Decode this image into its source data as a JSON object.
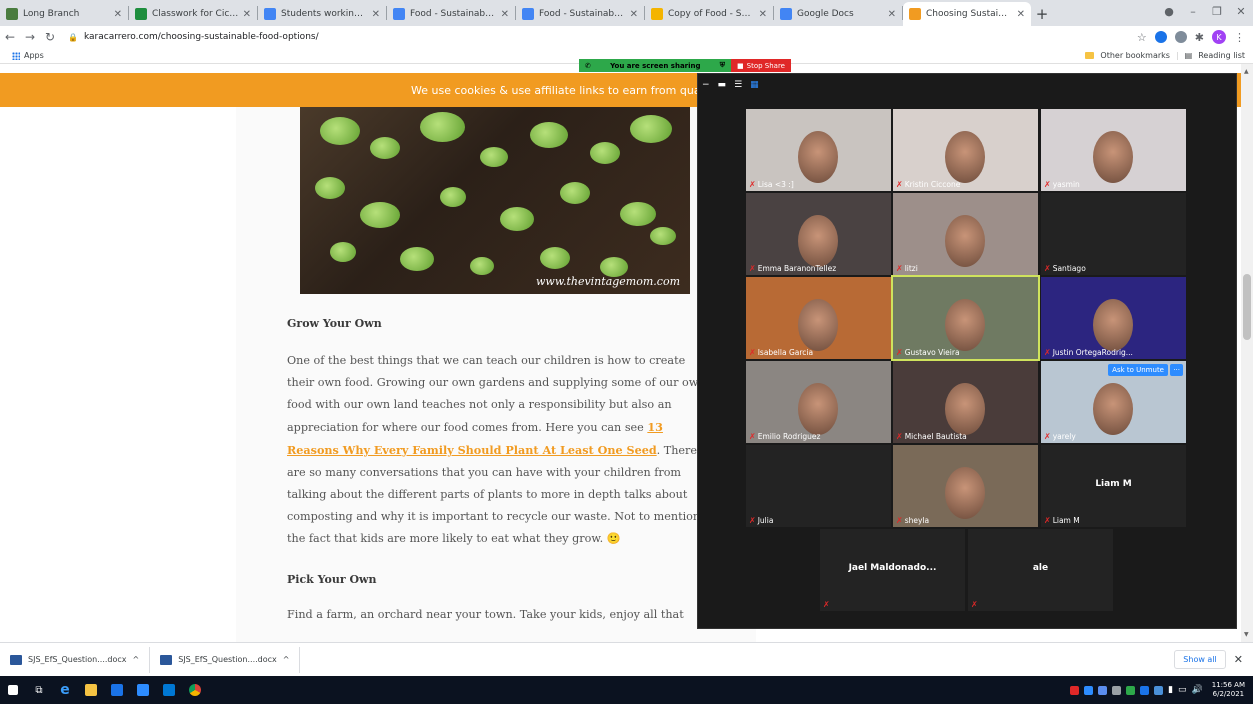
{
  "browser": {
    "tabs": [
      {
        "title": "Long Branch",
        "color": "#4a7c3f"
      },
      {
        "title": "Classwork for Ciccone - Ma",
        "color": "#1e8e3e"
      },
      {
        "title": "Students working - screens",
        "color": "#4285f4"
      },
      {
        "title": "Food - Sustainability - Goo",
        "color": "#4285f4"
      },
      {
        "title": "Food - Sustainability Lesso",
        "color": "#4285f4"
      },
      {
        "title": "Copy of Food - Sustainabl",
        "color": "#f4b400"
      },
      {
        "title": "Google Docs",
        "color": "#4285f4"
      },
      {
        "title": "Choosing Sustainable Foo",
        "color": "#f19b21",
        "active": true
      }
    ],
    "url": "karacarrero.com/choosing-sustainable-food-options/",
    "bookmarks": {
      "apps": "Apps",
      "other": "Other bookmarks",
      "reading": "Reading list"
    },
    "profile_initial": "K"
  },
  "share_bar": {
    "status": "You are screen sharing",
    "stop": "Stop Share"
  },
  "page": {
    "cookie_text": "We use cookies & use affiliate links to earn from qua",
    "image_watermark": "www.thevintagemom.com",
    "heading1": "Grow Your Own",
    "para1_a": "One of the best things that we can teach our children is how to create their own food. Growing our own gardens and supplying some of our own food with our own land teaches not only a responsibility but also an appreciation for where our food comes from. Here you can see ",
    "para1_link": "13 Reasons Why Every Family Should Plant At Least One Seed",
    "para1_b": ". There are so many conversations that you can have with your children from talking about the different parts of plants to more in depth talks about composting and why it is important to recycle our waste. Not to mention the fact that kids are more likely to eat what they grow. 🙂",
    "heading2": "Pick Your Own",
    "para2": "Find a farm, an orchard near your town. Take your kids, enjoy all that"
  },
  "zoom": {
    "participants": [
      {
        "name": "Lisa <3 :]",
        "video": true,
        "bg": "#c9c4c0"
      },
      {
        "name": "Kristin Ciccone",
        "video": true,
        "bg": "#d8d0cc"
      },
      {
        "name": "yasmin",
        "video": true,
        "bg": "#d6d1d3"
      },
      {
        "name": "Emma BaranonTellez",
        "video": true,
        "bg": "#4a4242"
      },
      {
        "name": "litzi",
        "video": true,
        "bg": "#9d8f8a"
      },
      {
        "name": "Santiago",
        "video": false,
        "bg": "#232323"
      },
      {
        "name": "Isabella Garcia",
        "video": true,
        "bg": "#b86a35"
      },
      {
        "name": "Gustavo Vieira",
        "video": true,
        "bg": "#6f7a62"
      },
      {
        "name": "Justin OrtegaRodrig...",
        "video": true,
        "bg": "#2c2580"
      },
      {
        "name": "Emilio Rodriguez",
        "video": true,
        "bg": "#8b8682"
      },
      {
        "name": "Michael Bautista",
        "video": true,
        "bg": "#4a3c3a"
      },
      {
        "name": "yarely",
        "video": true,
        "bg": "#b9c6d2"
      },
      {
        "name": "Julia",
        "video": false,
        "bg": "#232323"
      },
      {
        "name": "sheyla",
        "video": true,
        "bg": "#7a6a58"
      },
      {
        "name": "Liam M",
        "video": false,
        "bg": "#232323",
        "center": "Liam M"
      },
      {
        "name": "",
        "video": false,
        "bg": "#232323",
        "center": "Jael  Maldonado..."
      },
      {
        "name": "",
        "video": false,
        "bg": "#232323",
        "center": "ale"
      }
    ],
    "ask_unmute": "Ask to Unmute",
    "more": "···"
  },
  "downloads": {
    "items": [
      "SJS_EfS_Question....docx",
      "SJS_EfS_Question....docx"
    ],
    "show_all": "Show all"
  },
  "taskbar": {
    "time": "11:56 AM",
    "date": "6/2/2021"
  }
}
